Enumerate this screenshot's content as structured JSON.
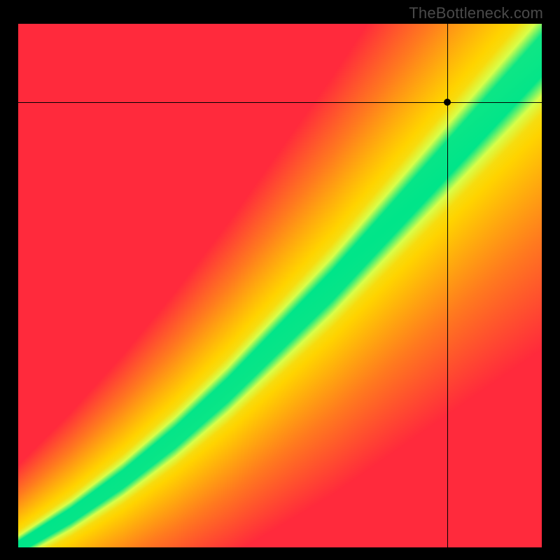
{
  "watermark": "TheBottleneck.com",
  "chart_data": {
    "type": "heatmap",
    "title": "",
    "xlabel": "",
    "ylabel": "",
    "xlim": [
      0,
      100
    ],
    "ylim": [
      0,
      100
    ],
    "grid": false,
    "legend": false,
    "color_stops": {
      "red": "#ff2a3c",
      "orange": "#ff7a1f",
      "yellow": "#ffd400",
      "lightgreen": "#d8ff4a",
      "green": "#00e58a"
    },
    "ideal_curve": {
      "description": "Approximate centerline of the green optimal band (y as a function of x, axes 0-100). Slight S-curve: compressed near origin, roughly y ≈ 0.78·x + nonlinear lift near the top.",
      "x": [
        0,
        5,
        10,
        15,
        20,
        25,
        30,
        35,
        40,
        45,
        50,
        55,
        60,
        65,
        70,
        75,
        80,
        85,
        90,
        95,
        100
      ],
      "y": [
        0,
        3,
        6,
        9.5,
        13,
        17,
        21,
        25.5,
        30,
        35,
        40,
        45,
        50,
        55.5,
        61,
        66.5,
        72,
        77.5,
        83,
        88.5,
        94
      ]
    },
    "green_band_halfwidth_y": 3.2,
    "yellow_band_halfwidth_y": 9.0,
    "marker": {
      "x": 82,
      "y": 85
    },
    "crosshair": {
      "x": 82,
      "y": 85
    }
  }
}
